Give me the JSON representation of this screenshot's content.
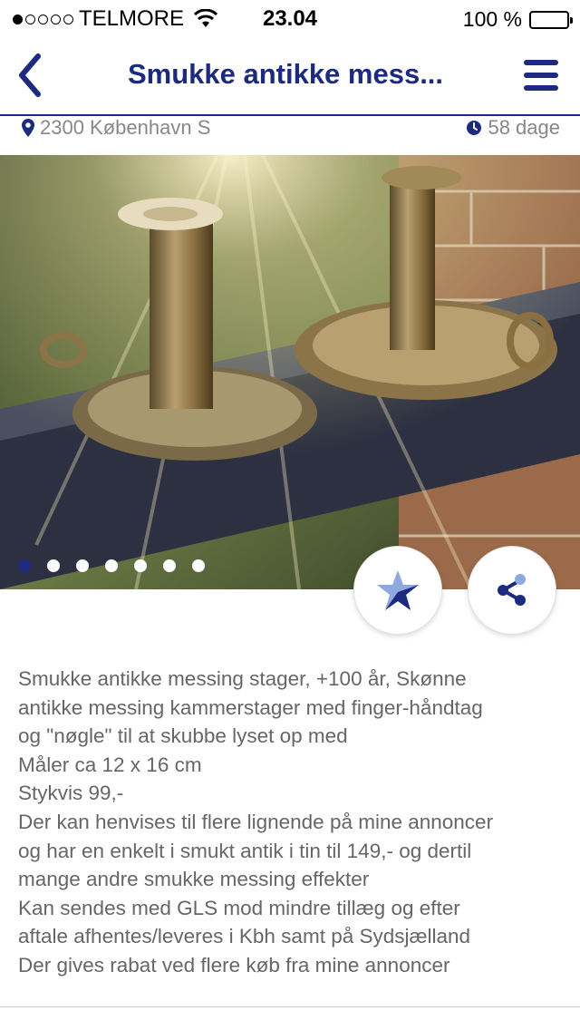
{
  "status_bar": {
    "carrier": "TELMORE",
    "time": "23.04",
    "battery": "100 %",
    "signal_strength": 1
  },
  "nav": {
    "title": "Smukke antikke mess...",
    "back_icon": "chevron-left-icon",
    "menu_icon": "hamburger-menu-icon"
  },
  "meta": {
    "location": "2300 København S",
    "location_icon": "map-pin-icon",
    "age": "58 dage",
    "age_icon": "clock-icon"
  },
  "gallery": {
    "image_count": 7,
    "active_index": 0,
    "favorite_icon": "star-icon",
    "share_icon": "share-icon"
  },
  "description": {
    "lines": [
      "Smukke antikke messing stager, +100 år, Skønne",
      "antikke messing kammerstager med finger-håndtag",
      "og \"nøgle\" til at skubbe lyset op med",
      "Måler ca 12 x 16 cm",
      "Stykvis 99,-",
      "Der kan henvises til flere lignende på mine annoncer",
      "og har en enkelt i smukt antik i tin til 149,- og dertil",
      "mange andre smukke messing effekter",
      "Kan sendes med GLS mod mindre tillæg og efter",
      "aftale afhentes/leveres i Kbh samt på Sydsjælland",
      "Der gives rabat ved flere køb fra mine annoncer"
    ]
  },
  "colors": {
    "brand": "#1c2a80",
    "meta_text": "#888888",
    "body_text": "#666666"
  }
}
